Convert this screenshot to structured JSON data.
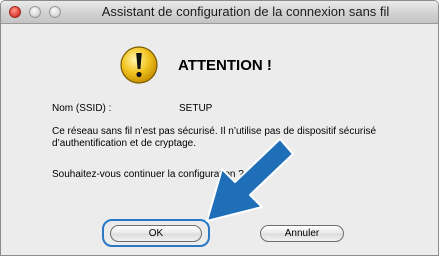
{
  "window": {
    "title": "Assistant de configuration de la connexion sans fil"
  },
  "alert": {
    "icon": "warning-icon",
    "heading": "ATTENTION !",
    "ssid_label": "Nom (SSID) :",
    "ssid_value": "SETUP",
    "message": "Ce réseau sans fil n’est pas sécurisé. Il n’utilise pas de dispositif sécurisé d’authentification et de cryptage.",
    "question": "Souhaitez-vous continuer la configuration ?"
  },
  "buttons": {
    "ok_label": "OK",
    "cancel_label": "Annuler"
  },
  "colors": {
    "accent": "#2a78c8",
    "arrow": "#1f6fb8",
    "warning": "#f3c623"
  }
}
